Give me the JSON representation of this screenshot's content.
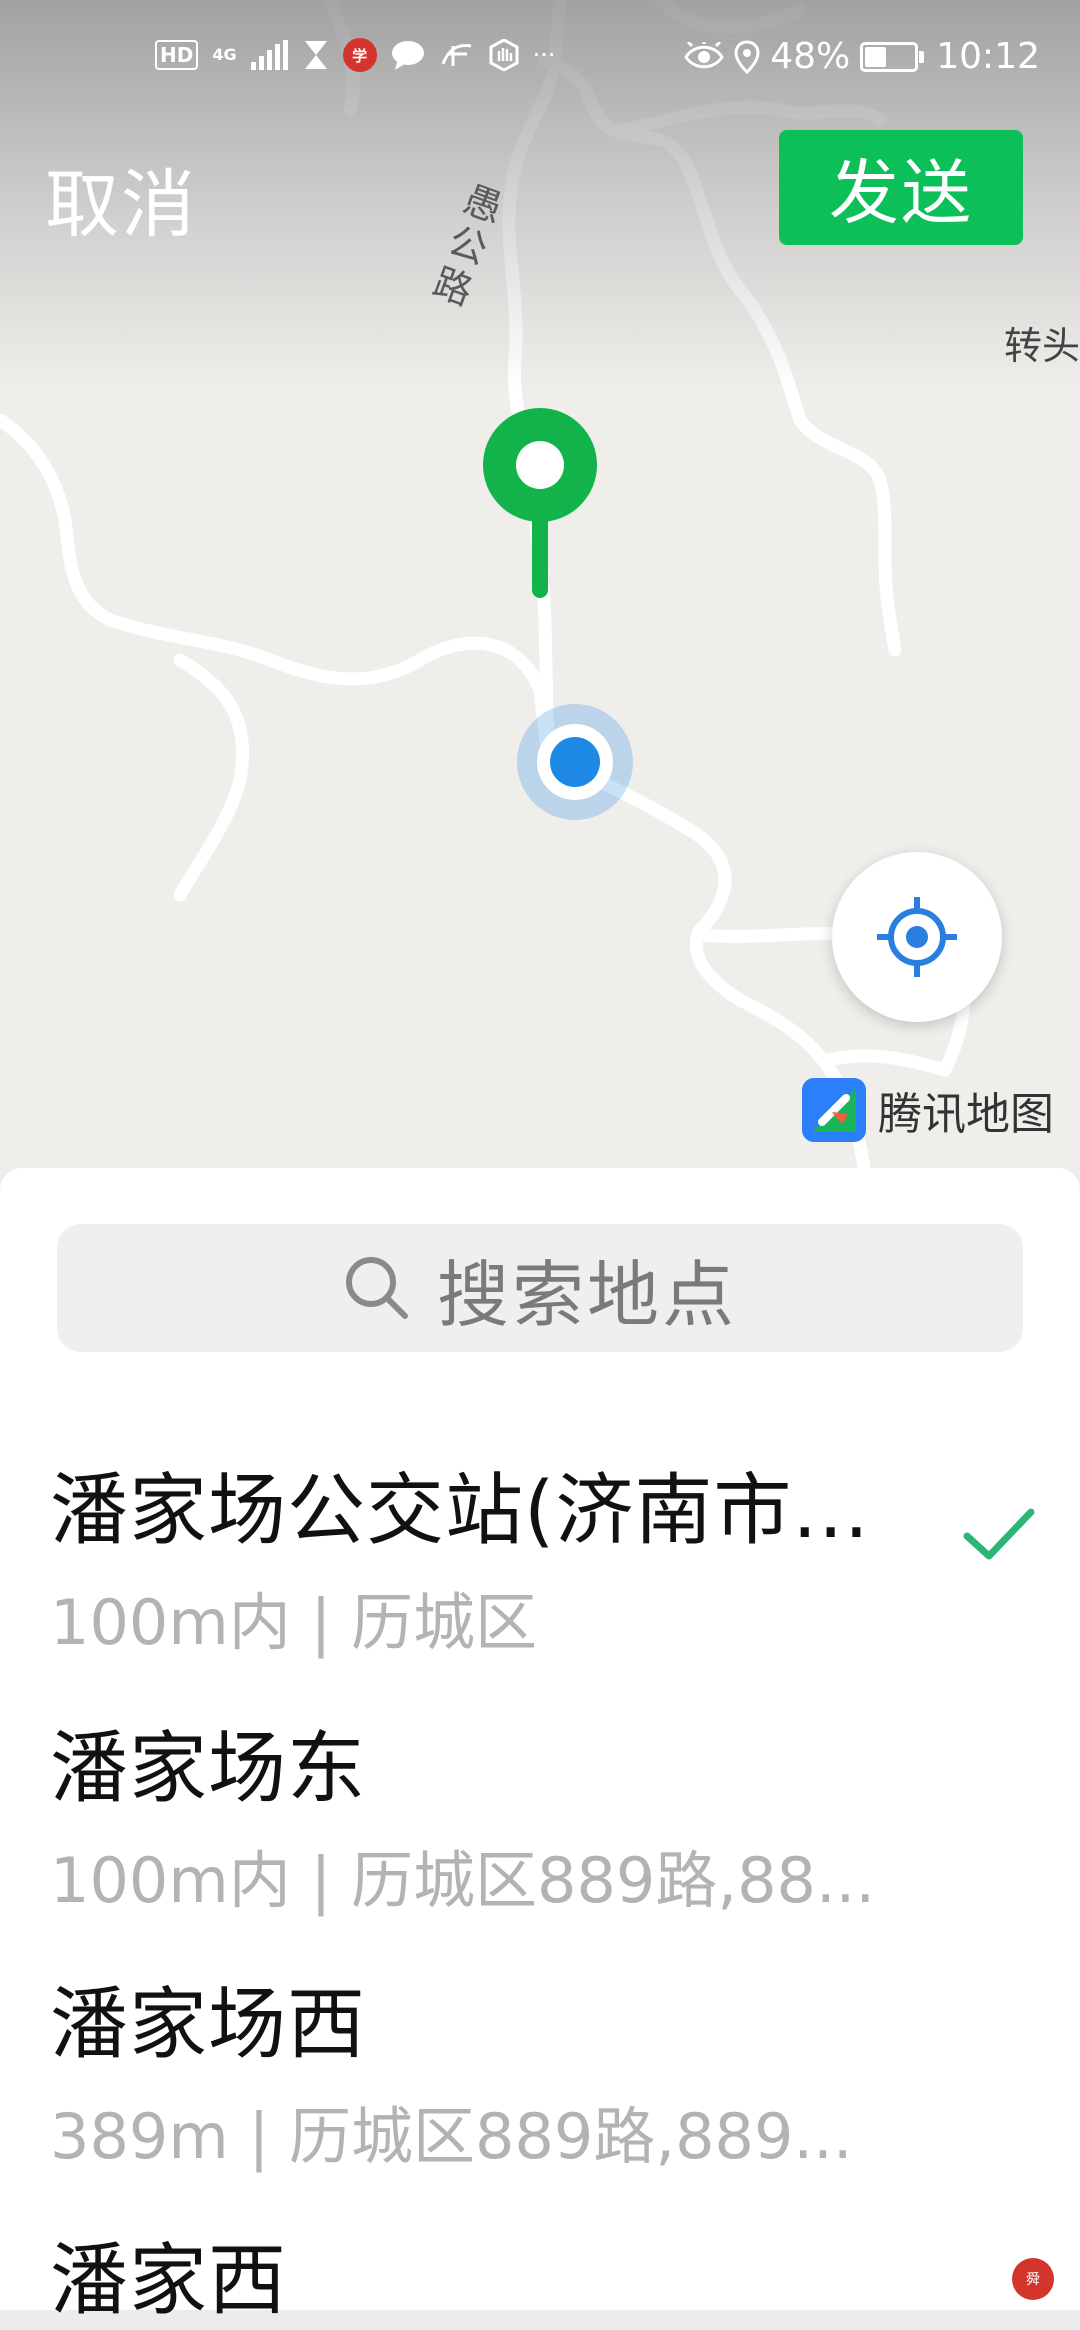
{
  "status_bar": {
    "left_items": [
      "HD",
      "4G",
      "signal",
      "hourglass",
      "news-app",
      "chat",
      "study-app",
      "hand-app",
      "…"
    ],
    "hd": "HD",
    "net": "4G",
    "more": "···",
    "battery_percent": "48%",
    "battery_level": 0.48,
    "time": "10:12"
  },
  "header": {
    "cancel_label": "取消",
    "send_label": "发送",
    "send_color": "#0dbf58"
  },
  "map": {
    "road_label": "愚公路",
    "place_label": "转头",
    "brand_label": "腾讯地图",
    "pin_color": "#12b34a",
    "location_color": "#1e88e5"
  },
  "search": {
    "placeholder": "搜索地点",
    "icon": "search-icon"
  },
  "results": [
    {
      "title": "潘家场公交站(济南市...",
      "subtitle": "100m内 | 历城区",
      "selected": true
    },
    {
      "title": "潘家场东",
      "subtitle": "100m内 | 历城区889路,88...",
      "selected": false
    },
    {
      "title": "潘家场西",
      "subtitle": "389m | 历城区889路,889...",
      "selected": false
    },
    {
      "title": "潘家西",
      "subtitle": "",
      "selected": false
    }
  ],
  "accent_check": "#2bb673"
}
